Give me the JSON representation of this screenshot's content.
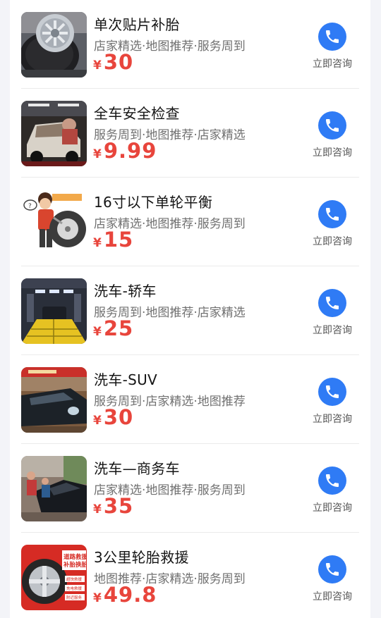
{
  "colors": {
    "price": "#e8453c",
    "call_button": "#2f7bf5",
    "page_bg": "#f3f4f8"
  },
  "services": [
    {
      "title": "单次贴片补胎",
      "tags": "店家精选·地图推荐·服务周到",
      "currency": "¥",
      "price": "30",
      "action": "立即咨询",
      "thumb": "tire-wheel-photo",
      "icon": "phone-icon"
    },
    {
      "title": "全车安全检查",
      "tags": "服务周到·地图推荐·店家精选",
      "currency": "¥",
      "price": "9.99",
      "action": "立即咨询",
      "thumb": "car-inspection-photo",
      "icon": "phone-icon"
    },
    {
      "title": "16寸以下单轮平衡",
      "tags": "店家精选·地图推荐·服务周到",
      "currency": "¥",
      "price": "15",
      "action": "立即咨询",
      "thumb": "wheel-balance-cartoon",
      "icon": "phone-icon"
    },
    {
      "title": "洗车-轿车",
      "tags": "服务周到·地图推荐·店家精选",
      "currency": "¥",
      "price": "25",
      "action": "立即咨询",
      "thumb": "car-wash-bay-photo",
      "icon": "phone-icon"
    },
    {
      "title": "洗车-SUV",
      "tags": "服务周到·店家精选·地图推荐",
      "currency": "¥",
      "price": "30",
      "action": "立即咨询",
      "thumb": "suv-wash-photo",
      "icon": "phone-icon"
    },
    {
      "title": "洗车—商务车",
      "tags": "店家精选·地图推荐·服务周到",
      "currency": "¥",
      "price": "35",
      "action": "立即咨询",
      "thumb": "business-car-wash-photo",
      "icon": "phone-icon"
    },
    {
      "title": "3公里轮胎救援",
      "tags": "地图推荐·店家精选·服务周到",
      "currency": "¥",
      "price": "49.8",
      "action": "立即咨询",
      "thumb": "tire-rescue-poster",
      "poster": {
        "headline_1": "道路救援",
        "headline_2": "补胎换胎",
        "chip_1": "超快救援",
        "chip_2": "充电救援",
        "chip_3": "附近服务"
      },
      "icon": "phone-icon"
    }
  ]
}
